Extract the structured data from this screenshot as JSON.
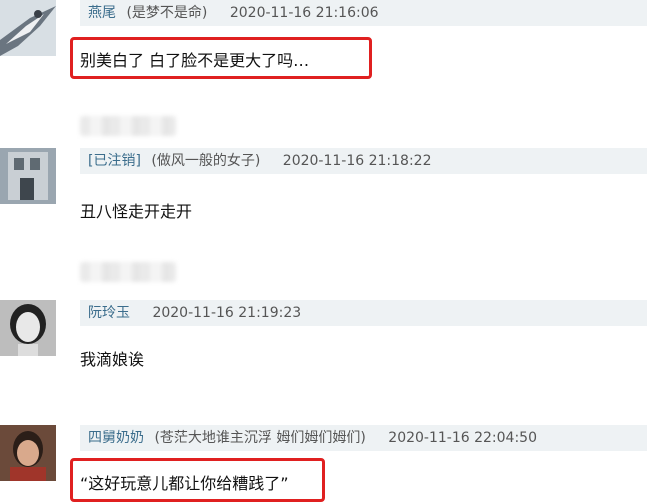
{
  "comments": [
    {
      "username": "燕尾",
      "nickname": "(是梦不是命)",
      "timestamp": "2020-11-16 21:16:06",
      "text": "别美白了 白了脸不是更大了吗…",
      "highlighted": true
    },
    {
      "username": "[已注销]",
      "nickname": "(做风一般的女子)",
      "timestamp": "2020-11-16 21:18:22",
      "text": "丑八怪走开走开",
      "highlighted": false
    },
    {
      "username": "阮玲玉",
      "nickname": "",
      "timestamp": "2020-11-16 21:19:23",
      "text": "我滴娘诶",
      "highlighted": false
    },
    {
      "username": "四舅奶奶",
      "nickname": "(苍茫大地谁主沉浮 姆们姆们姆们)",
      "timestamp": "2020-11-16 22:04:50",
      "text": "“这好玩意儿都让你给糟践了”",
      "highlighted": true
    }
  ],
  "colors": {
    "header_bg": "#eef2f4",
    "username": "#3b6d8c",
    "highlight_border": "#e02020"
  }
}
